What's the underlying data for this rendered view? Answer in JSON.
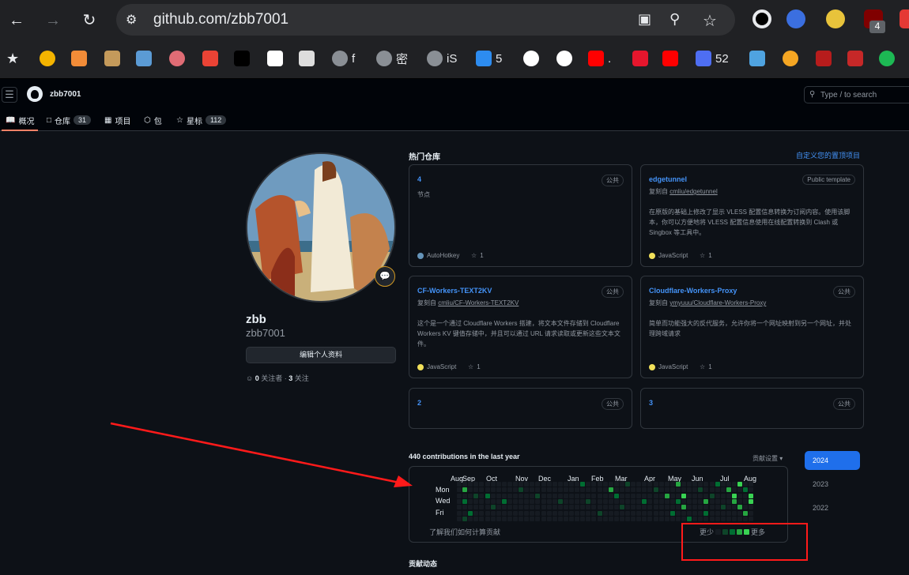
{
  "browser": {
    "url": "github.com/zbb7001",
    "extension_badge": "4",
    "bookmarks": [
      {
        "icon": "star-icon",
        "label": ""
      },
      {
        "icon": "photos-icon",
        "label": ""
      },
      {
        "icon": "peach-icon",
        "label": ""
      },
      {
        "icon": "painting-icon",
        "label": ""
      },
      {
        "icon": "hux-icon",
        "label": ""
      },
      {
        "icon": "globe-ring-icon",
        "label": ""
      },
      {
        "icon": "gmail-icon",
        "label": ""
      },
      {
        "icon": "pattern-icon",
        "label": ""
      },
      {
        "icon": "openai-icon",
        "label": ""
      },
      {
        "icon": "terminal-icon",
        "label": ""
      },
      {
        "icon": "globe-icon",
        "label": "f"
      },
      {
        "icon": "globe-icon",
        "label": "密"
      },
      {
        "icon": "globe-icon",
        "label": "iS"
      },
      {
        "icon": "cloud-icon",
        "label": "5"
      },
      {
        "icon": "github-icon",
        "label": ""
      },
      {
        "icon": "google-icon",
        "label": ""
      },
      {
        "icon": "youtube-icon",
        "label": "."
      },
      {
        "icon": "weibo-icon",
        "label": ""
      },
      {
        "icon": "youtube-icon",
        "label": ""
      },
      {
        "icon": "q-icon",
        "label": "52"
      },
      {
        "icon": "flower-icon",
        "label": ""
      },
      {
        "icon": "orange-icon",
        "label": ""
      },
      {
        "icon": "red-square-icon",
        "label": ""
      },
      {
        "icon": "stamp-icon",
        "label": ""
      },
      {
        "icon": "spotify-icon",
        "label": ""
      }
    ]
  },
  "header": {
    "username": "zbb7001",
    "search_placeholder": "Type / to search",
    "tabs": [
      {
        "label": "概况",
        "count": ""
      },
      {
        "label": "仓库",
        "count": "31"
      },
      {
        "label": "项目",
        "count": ""
      },
      {
        "label": "包",
        "count": ""
      },
      {
        "label": "星标",
        "count": "112"
      }
    ]
  },
  "profile": {
    "name": "zbb",
    "login": "zbb7001",
    "edit_label": "编辑个人资料",
    "followers": "0",
    "followers_label": "关注者",
    "following": "3",
    "following_label": "关注"
  },
  "pinned": {
    "title": "热门仓库",
    "customize": "自定义您的置顶项目",
    "cards": [
      {
        "name": "4",
        "badge": "公共",
        "fork": "",
        "fork_src": "",
        "desc": "节点",
        "lang": "AutoHotkey",
        "lang_color": "#6594b9",
        "stars": "1"
      },
      {
        "name": "edgetunnel",
        "badge": "Public template",
        "fork": "复刻自",
        "fork_src": "cmliu/edgetunnel",
        "desc": "在原版的基础上修改了显示 VLESS 配置信息转换为订阅内容。使用该脚本，你可以方便地将 VLESS 配置信息使用在线配置转换到 Clash 或 Singbox 等工具中。",
        "lang": "JavaScript",
        "lang_color": "#f1e05a",
        "stars": "1"
      },
      {
        "name": "CF-Workers-TEXT2KV",
        "badge": "公共",
        "fork": "复刻自",
        "fork_src": "cmliu/CF-Workers-TEXT2KV",
        "desc": "这个是一个通过 Cloudflare Workers 搭建，将文本文件存储到 Cloudflare Workers KV 键值存储中，并且可以通过 URL 请求读取或更新这些文本文件。",
        "lang": "JavaScript",
        "lang_color": "#f1e05a",
        "stars": "1"
      },
      {
        "name": "Cloudflare-Workers-Proxy",
        "badge": "公共",
        "fork": "复刻自",
        "fork_src": "ymyuuu/Cloudflare-Workers-Proxy",
        "desc": "简单而功能强大的反代服务，允许你将一个网址映射到另一个网址，并处理跨域请求",
        "lang": "JavaScript",
        "lang_color": "#f1e05a",
        "stars": "1"
      },
      {
        "name": "2",
        "badge": "公共",
        "fork": "",
        "fork_src": "",
        "desc": "",
        "lang": "",
        "lang_color": "",
        "stars": ""
      },
      {
        "name": "3",
        "badge": "公共",
        "fork": "",
        "fork_src": "",
        "desc": "",
        "lang": "",
        "lang_color": "",
        "stars": ""
      }
    ]
  },
  "contributions": {
    "title": "440 contributions in the last year",
    "settings": "贡献设置 ▾",
    "months": [
      "Aug",
      "Sep",
      "Oct",
      "Nov",
      "Dec",
      "Jan",
      "Feb",
      "Mar",
      "Apr",
      "May",
      "Jun",
      "Jul",
      "Aug"
    ],
    "weekdays": [
      "Mon",
      "Wed",
      "Fri"
    ],
    "learn": "了解我们如何计算贡献",
    "less": "更少",
    "more": "更多",
    "years": [
      "2024",
      "2023",
      "2022"
    ],
    "active_year": "2024",
    "levels_colors": [
      "#161b22",
      "#0e4429",
      "#006d32",
      "#26a641",
      "#39d353"
    ]
  },
  "activity": {
    "title": "贡献动态"
  }
}
